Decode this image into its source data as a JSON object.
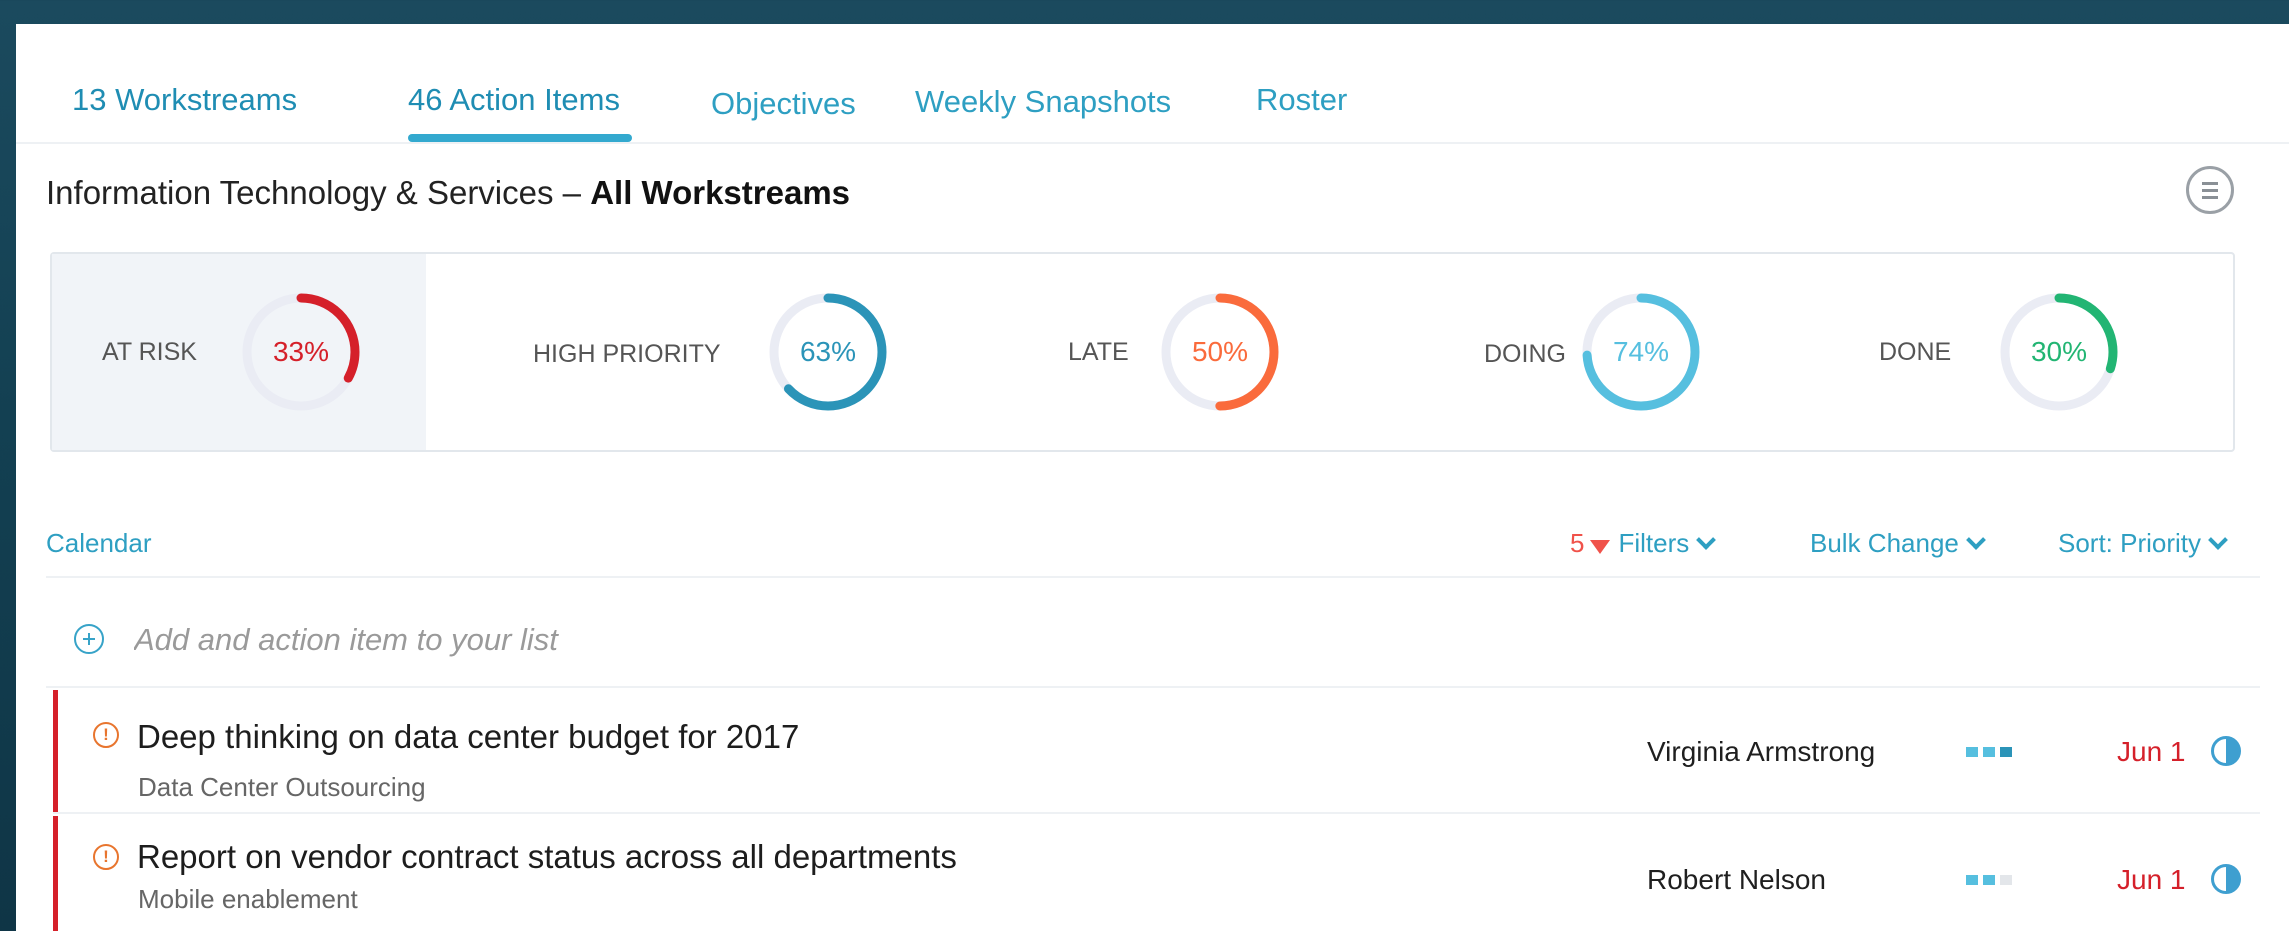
{
  "tabs": [
    {
      "label": "13 Workstreams"
    },
    {
      "label": "46 Action Items"
    },
    {
      "label": "Objectives"
    },
    {
      "label": "Weekly Snapshots"
    },
    {
      "label": "Roster"
    }
  ],
  "header": {
    "title_prefix": "Information Technology & Services – ",
    "title_bold": "All Workstreams",
    "menu_icon": "list-menu-icon"
  },
  "stats": [
    {
      "label": "AT RISK",
      "pct_text": "33%",
      "fraction": 0.33,
      "color": "#d5202a"
    },
    {
      "label": "HIGH PRIORITY",
      "pct_text": "63%",
      "fraction": 0.63,
      "color": "#2b94b8"
    },
    {
      "label": "LATE",
      "pct_text": "50%",
      "fraction": 0.5,
      "color": "#fa6b3c"
    },
    {
      "label": "DOING",
      "pct_text": "74%",
      "fraction": 0.74,
      "color": "#56bfdf"
    },
    {
      "label": "DONE",
      "pct_text": "30%",
      "fraction": 0.3,
      "color": "#22b573"
    }
  ],
  "toolbar": {
    "calendar": "Calendar",
    "filter_count": "5",
    "filters": "Filters",
    "bulk_change": "Bulk Change",
    "sort": "Sort: Priority"
  },
  "add_item": {
    "placeholder": "Add and action item to your list"
  },
  "items": [
    {
      "title": "Deep thinking on data center budget for 2017",
      "workstream": "Data Center Outsourcing",
      "owner": "Virginia Armstrong",
      "priority_level": 3,
      "due": "Jun 1",
      "status_icon": "half-circle-icon"
    },
    {
      "title": "Report on vendor contract status across all departments",
      "workstream": "Mobile enablement",
      "owner": "Robert Nelson",
      "priority_level": 2,
      "due": "Jun 1",
      "status_icon": "half-circle-icon"
    }
  ],
  "colors": {
    "accent": "#2e9fc2",
    "at_risk": "#d5202a",
    "alert": "#e8752e"
  }
}
